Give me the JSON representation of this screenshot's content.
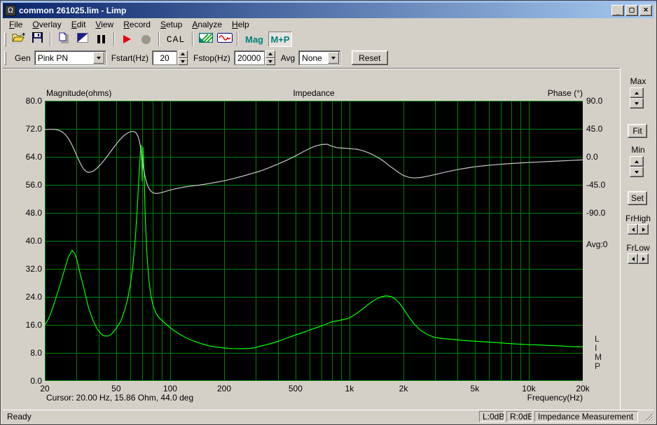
{
  "window": {
    "title": "common 261025.lim - Limp",
    "icon_glyph": "Ω"
  },
  "menu": {
    "items": [
      "File",
      "Overlay",
      "Edit",
      "View",
      "Record",
      "Setup",
      "Analyze",
      "Help"
    ]
  },
  "toolbar": {
    "cal": "CAL",
    "mag": "Mag",
    "mp": "M+P"
  },
  "controls": {
    "gen_label": "Gen",
    "gen_value": "Pink PN",
    "fstart_label": "Fstart(Hz)",
    "fstart_value": "20",
    "fstop_label": "Fstop(Hz)",
    "fstop_value": "20000",
    "avg_label": "Avg",
    "avg_value": "None",
    "reset": "Reset"
  },
  "side_panel": {
    "max": "Max",
    "fit": "Fit",
    "min": "Min",
    "set": "Set",
    "frhigh": "FrHigh",
    "frlow": "FrLow"
  },
  "chart": {
    "mag_title": "Magnitude(ohms)",
    "center_title": "Impedance",
    "phase_title": "Phase (°)",
    "freq_title": "Frequency(Hz)",
    "cursor_readout": "Cursor: 20.00 Hz, 15.86 Ohm, 44.0 deg",
    "avg_counter": "Avg:0",
    "watermark": [
      "L",
      "I",
      "M",
      "P"
    ],
    "mag_ticks": [
      {
        "label": "80.0",
        "v": 80
      },
      {
        "label": "72.0",
        "v": 72
      },
      {
        "label": "64.0",
        "v": 64
      },
      {
        "label": "56.0",
        "v": 56
      },
      {
        "label": "48.0",
        "v": 48
      },
      {
        "label": "40.0",
        "v": 40
      },
      {
        "label": "32.0",
        "v": 32
      },
      {
        "label": "24.0",
        "v": 24
      },
      {
        "label": "16.0",
        "v": 16
      },
      {
        "label": "8.0",
        "v": 8
      },
      {
        "label": "0.0",
        "v": 0
      }
    ],
    "phase_ticks": [
      {
        "label": "90.0",
        "v": 90
      },
      {
        "label": "45.0",
        "v": 45
      },
      {
        "label": "0.0",
        "v": 0
      },
      {
        "label": "-45.0",
        "v": -45
      },
      {
        "label": "-90.0",
        "v": -90
      }
    ],
    "freq_ticks": [
      {
        "label": "20",
        "f": 20
      },
      {
        "label": "50",
        "f": 50
      },
      {
        "label": "100",
        "f": 100
      },
      {
        "label": "200",
        "f": 200
      },
      {
        "label": "500",
        "f": 500
      },
      {
        "label": "1k",
        "f": 1000
      },
      {
        "label": "2k",
        "f": 2000
      },
      {
        "label": "5k",
        "f": 5000
      },
      {
        "label": "10k",
        "f": 10000
      },
      {
        "label": "20k",
        "f": 20000
      }
    ]
  },
  "chart_data": {
    "type": "line",
    "title": "Impedance",
    "x_scale": "log",
    "x_range_hz": [
      20,
      20000
    ],
    "mag_axis": {
      "label": "Magnitude(ohms)",
      "min": 0,
      "max": 80,
      "step": 8
    },
    "phase_axis": {
      "label": "Phase (°)",
      "top_deg": 90,
      "deg_per_division": 45,
      "tick_values": [
        90,
        45,
        0,
        -45,
        -90
      ]
    },
    "grid": {
      "color": "#008000",
      "vertical_lines_hz": [
        30,
        40,
        50,
        60,
        70,
        80,
        90,
        100,
        200,
        300,
        400,
        500,
        600,
        700,
        800,
        900,
        1000,
        2000,
        3000,
        4000,
        5000,
        6000,
        7000,
        8000,
        9000,
        10000,
        20000
      ],
      "horizontal_divisions": 10
    },
    "cursor": {
      "freq_hz": 20.0,
      "magnitude_ohm": 15.86,
      "phase_deg": 44.0
    },
    "averages": 0,
    "legend_position": "none",
    "series": [
      {
        "name": "impedance_magnitude_ohm",
        "axis": "mag",
        "color": "#00ff00",
        "points": [
          [
            20,
            15.9
          ],
          [
            21,
            17.8
          ],
          [
            22,
            20.5
          ],
          [
            23,
            23.5
          ],
          [
            24,
            26.5
          ],
          [
            25,
            29.5
          ],
          [
            26,
            32.5
          ],
          [
            27,
            35.3
          ],
          [
            28.4,
            37.3
          ],
          [
            29.5,
            36.2
          ],
          [
            30.2,
            34.6
          ],
          [
            31.5,
            30.5
          ],
          [
            33,
            26.5
          ],
          [
            35,
            21
          ],
          [
            37,
            17.5
          ],
          [
            39,
            15
          ],
          [
            41,
            13.5
          ],
          [
            42.5,
            12.9
          ],
          [
            45,
            12.8
          ],
          [
            47,
            13.3
          ],
          [
            50,
            15
          ],
          [
            53,
            17
          ],
          [
            56,
            20.5
          ],
          [
            58,
            23.5
          ],
          [
            60,
            27.5
          ],
          [
            62,
            33
          ],
          [
            64,
            41
          ],
          [
            65.5,
            49
          ],
          [
            67,
            58.5
          ],
          [
            68.3,
            65.5
          ],
          [
            69,
            67.4
          ],
          [
            69.8,
            57
          ],
          [
            70.6,
            66.8
          ],
          [
            71.5,
            60
          ],
          [
            72.5,
            48
          ],
          [
            74,
            37
          ],
          [
            76,
            29
          ],
          [
            78,
            24.5
          ],
          [
            80,
            21.8
          ],
          [
            83,
            19.5
          ],
          [
            86,
            18.2
          ],
          [
            90,
            17.3
          ],
          [
            95,
            16.2
          ],
          [
            100,
            15.2
          ],
          [
            107,
            14.1
          ],
          [
            115,
            13.1
          ],
          [
            125,
            12.1
          ],
          [
            135,
            11.4
          ],
          [
            150,
            10.6
          ],
          [
            165,
            10
          ],
          [
            180,
            9.7
          ],
          [
            200,
            9.4
          ],
          [
            220,
            9.25
          ],
          [
            250,
            9.2
          ],
          [
            280,
            9.3
          ],
          [
            300,
            9.5
          ],
          [
            310,
            9.8
          ],
          [
            330,
            10.1
          ],
          [
            360,
            10.6
          ],
          [
            400,
            11.3
          ],
          [
            440,
            12.1
          ],
          [
            480,
            12.8
          ],
          [
            520,
            13.4
          ],
          [
            570,
            14.1
          ],
          [
            620,
            14.8
          ],
          [
            680,
            15.5
          ],
          [
            740,
            16.2
          ],
          [
            800,
            16.9
          ],
          [
            850,
            17.1
          ],
          [
            900,
            17.4
          ],
          [
            960,
            17.7
          ],
          [
            1000,
            18
          ],
          [
            1100,
            19.3
          ],
          [
            1200,
            20.8
          ],
          [
            1300,
            22.2
          ],
          [
            1400,
            23.3
          ],
          [
            1500,
            24
          ],
          [
            1600,
            24.3
          ],
          [
            1700,
            24.1
          ],
          [
            1800,
            23.4
          ],
          [
            1900,
            22.2
          ],
          [
            2000,
            20.6
          ],
          [
            2150,
            18.2
          ],
          [
            2300,
            16.2
          ],
          [
            2500,
            14.4
          ],
          [
            2700,
            13.3
          ],
          [
            3000,
            12.4
          ],
          [
            3300,
            12.1
          ],
          [
            3700,
            11.9
          ],
          [
            4200,
            11.6
          ],
          [
            4800,
            11.4
          ],
          [
            5500,
            11.2
          ],
          [
            6300,
            11
          ],
          [
            7200,
            10.8
          ],
          [
            8200,
            10.6
          ],
          [
            9500,
            10.4
          ],
          [
            11000,
            10.3
          ],
          [
            13000,
            10.1
          ],
          [
            15000,
            10
          ],
          [
            17000,
            9.8
          ],
          [
            20000,
            9.7
          ]
        ]
      },
      {
        "name": "impedance_phase_deg",
        "axis": "phase",
        "color": "#c8c8c8",
        "points": [
          [
            20,
            44
          ],
          [
            21,
            44.2
          ],
          [
            22,
            44.3
          ],
          [
            23,
            44
          ],
          [
            24,
            42.5
          ],
          [
            25,
            40
          ],
          [
            26,
            36
          ],
          [
            27,
            30
          ],
          [
            28,
            22
          ],
          [
            29,
            13
          ],
          [
            30,
            3
          ],
          [
            31,
            -6
          ],
          [
            32,
            -14
          ],
          [
            33,
            -20
          ],
          [
            34,
            -23.5
          ],
          [
            35,
            -25
          ],
          [
            36,
            -24.5
          ],
          [
            37.5,
            -22.5
          ],
          [
            39,
            -18.5
          ],
          [
            41,
            -12
          ],
          [
            43,
            -5
          ],
          [
            45,
            2.5
          ],
          [
            47,
            10
          ],
          [
            49,
            17
          ],
          [
            51,
            23.5
          ],
          [
            53,
            29
          ],
          [
            55,
            33.5
          ],
          [
            57,
            37
          ],
          [
            59,
            39.5
          ],
          [
            61,
            40.8
          ],
          [
            63,
            40.5
          ],
          [
            64.5,
            38.5
          ],
          [
            66,
            34
          ],
          [
            67,
            28
          ],
          [
            68,
            19
          ],
          [
            69,
            7
          ],
          [
            70,
            -6
          ],
          [
            71,
            -18
          ],
          [
            72,
            -28
          ],
          [
            73.5,
            -39
          ],
          [
            75,
            -47
          ],
          [
            77,
            -53
          ],
          [
            79,
            -56.5
          ],
          [
            81,
            -58.3
          ],
          [
            84,
            -59
          ],
          [
            88,
            -58
          ],
          [
            92,
            -56.5
          ],
          [
            97,
            -54.5
          ],
          [
            103,
            -52.5
          ],
          [
            110,
            -50.5
          ],
          [
            120,
            -48.5
          ],
          [
            130,
            -47
          ],
          [
            145,
            -45.5
          ],
          [
            160,
            -43.5
          ],
          [
            180,
            -41
          ],
          [
            200,
            -38.5
          ],
          [
            225,
            -35
          ],
          [
            250,
            -31.5
          ],
          [
            280,
            -27.5
          ],
          [
            320,
            -22.5
          ],
          [
            360,
            -17
          ],
          [
            400,
            -11.5
          ],
          [
            450,
            -5
          ],
          [
            500,
            1.5
          ],
          [
            550,
            8
          ],
          [
            600,
            13.5
          ],
          [
            650,
            17.5
          ],
          [
            700,
            19.8
          ],
          [
            750,
            20.3
          ],
          [
            800,
            17
          ],
          [
            850,
            14.8
          ],
          [
            900,
            14.2
          ],
          [
            1000,
            13.2
          ],
          [
            1100,
            12.3
          ],
          [
            1200,
            9.5
          ],
          [
            1300,
            5.5
          ],
          [
            1400,
            1
          ],
          [
            1500,
            -4
          ],
          [
            1600,
            -10
          ],
          [
            1700,
            -16
          ],
          [
            1800,
            -21
          ],
          [
            1900,
            -26
          ],
          [
            2000,
            -30
          ],
          [
            2150,
            -33
          ],
          [
            2300,
            -34
          ],
          [
            2500,
            -33.2
          ],
          [
            2800,
            -30.5
          ],
          [
            3100,
            -27.5
          ],
          [
            3500,
            -24
          ],
          [
            4000,
            -20.5
          ],
          [
            4500,
            -18
          ],
          [
            5000,
            -16
          ],
          [
            5700,
            -14.2
          ],
          [
            6500,
            -12.6
          ],
          [
            7500,
            -11.2
          ],
          [
            8500,
            -10.2
          ],
          [
            10000,
            -9
          ],
          [
            11500,
            -8.2
          ],
          [
            13000,
            -7.4
          ],
          [
            15000,
            -6.6
          ],
          [
            17000,
            -5.8
          ],
          [
            20000,
            -4.9
          ]
        ]
      }
    ]
  },
  "status_bar": {
    "ready": "Ready",
    "panels": [
      "L:0dB",
      "R:0dB",
      "Impedance Measurement"
    ]
  },
  "colors": {
    "window_bg": "#d4d0c8",
    "plot_bg": "#000000",
    "grid": "#008000",
    "magnitude_curve": "#00ff00",
    "phase_curve": "#c8c8c8",
    "teal_accent": "#008080",
    "title_gradient_left": "#0a246a",
    "title_gradient_right": "#a6caf0"
  }
}
